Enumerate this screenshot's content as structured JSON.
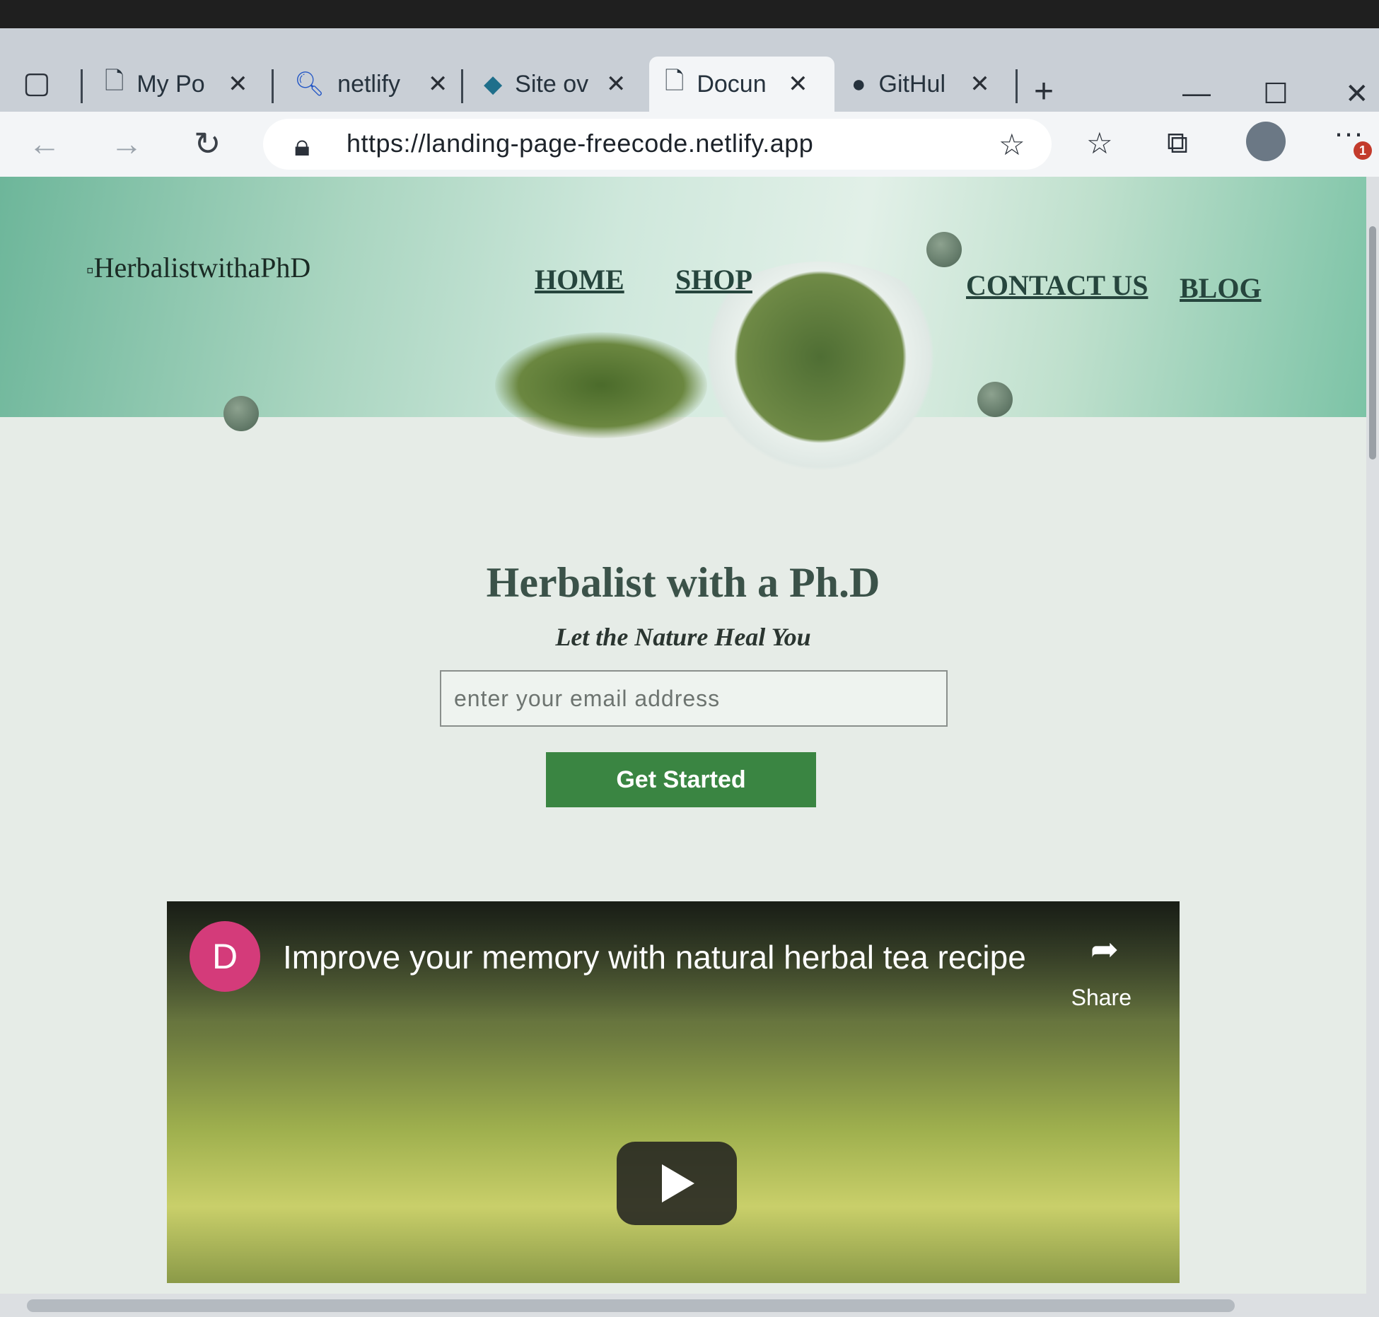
{
  "browser": {
    "tabs": [
      {
        "title": "My Po",
        "icon": "page-icon"
      },
      {
        "title": "netlify",
        "icon": "search-icon"
      },
      {
        "title": "Site ov",
        "icon": "netlify-diamond-icon"
      },
      {
        "title": "Docun",
        "icon": "page-icon"
      },
      {
        "title": "GitHul",
        "icon": "github-icon"
      }
    ],
    "active_tab_index": 3,
    "address_url": "https://landing-page-freecode.netlify.app",
    "notification_count": "1"
  },
  "site": {
    "logo_alt": "HerbalistwithaPhD",
    "nav": [
      "HOME",
      "SHOP",
      "CONTACT US",
      "BLOG"
    ],
    "headline": "Herbalist with a Ph.D",
    "tagline": "Let the Nature Heal You",
    "email_placeholder": "enter your email address",
    "cta_label": "Get Started",
    "video": {
      "channel_initial": "D",
      "title": "Improve your memory with natural herbal tea recipe",
      "share_label": "Share"
    }
  },
  "colors": {
    "cta": "#3a8542",
    "headline": "#3b5249",
    "channel_avatar": "#d43b7a"
  }
}
